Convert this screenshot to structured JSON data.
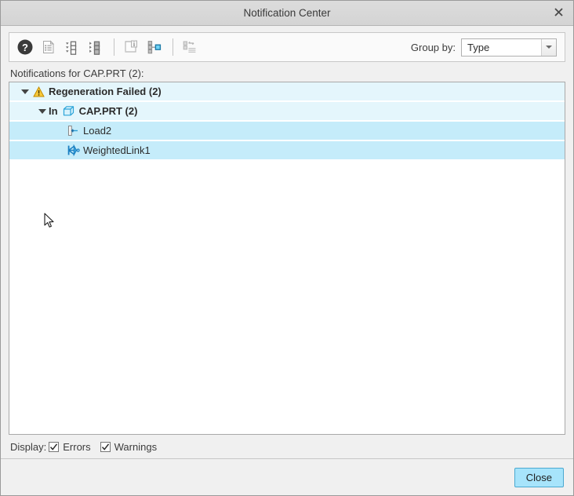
{
  "window": {
    "title": "Notification Center",
    "close_icon": "close-x-icon"
  },
  "toolbar": {
    "buttons": [
      {
        "name": "help-button",
        "icon": "question-mark-circle-icon",
        "enabled": true
      },
      {
        "name": "show-details-button",
        "icon": "document-list-icon",
        "enabled": false
      },
      {
        "name": "expand-all-button",
        "icon": "expand-all-tree-icon",
        "enabled": true
      },
      {
        "name": "collapse-all-button",
        "icon": "collapse-all-tree-icon",
        "enabled": true
      },
      {
        "name": "show-info-button",
        "icon": "page-info-icon",
        "enabled": false
      },
      {
        "name": "show-in-model-tree-button",
        "icon": "model-tree-node-icon",
        "enabled": true
      },
      {
        "name": "sort-notifications-button",
        "icon": "sort-swap-list-icon",
        "enabled": false
      }
    ],
    "group_by_label": "Group by:",
    "group_by_value": "Type",
    "group_by_options": [
      "Type"
    ],
    "dropdown_icon": "chevron-down-icon"
  },
  "content": {
    "notifications_label": "Notifications for CAP.PRT (2):",
    "tree": [
      {
        "level": 0,
        "twisty": "triangle-down",
        "icon": "warning-triangle-icon",
        "label": "Regeneration Failed (2)",
        "bold": true,
        "selected": false
      },
      {
        "level": 1,
        "twisty": "triangle-down",
        "prefix": "In",
        "icon": "part-cube-icon",
        "label": "CAP.PRT (2)",
        "bold": true,
        "selected": false
      },
      {
        "level": 2,
        "twisty": "none",
        "icon": "load-constraint-icon",
        "label": "Load2",
        "bold": false,
        "selected": true
      },
      {
        "level": 2,
        "twisty": "none",
        "icon": "weighted-link-icon",
        "label": "WeightedLink1",
        "bold": false,
        "selected": true
      }
    ]
  },
  "display": {
    "label": "Display:",
    "options": [
      {
        "name": "errors",
        "label": "Errors",
        "checked": true
      },
      {
        "name": "warnings",
        "label": "Warnings",
        "checked": true
      }
    ]
  },
  "footer": {
    "close_label": "Close"
  },
  "colors": {
    "row_group": "#e4f6fc",
    "row_selected": "#c5ecfa",
    "accent_button": "#a7e4fb",
    "warning": "#f4b41a",
    "part_icon": "#2aa3d8",
    "link_icon": "#1a7fc1"
  }
}
